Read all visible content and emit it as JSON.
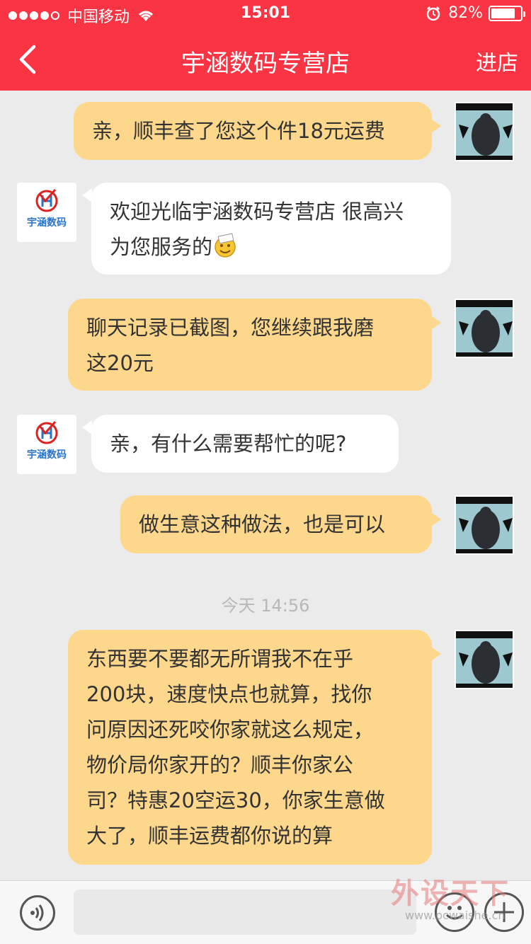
{
  "status_bar": {
    "carrier": "中国移动",
    "time": "15:01",
    "battery_percent": "82%",
    "battery_level": 0.82,
    "signal_bars": 4
  },
  "nav": {
    "title": "宇涵数码专营店",
    "right_label": "进店",
    "back_icon": "chevron-left-icon"
  },
  "shop": {
    "logo_text": "宇涵数码"
  },
  "messages": [
    {
      "from": "user",
      "text": "亲，顺丰查了您这个件18元运费"
    },
    {
      "from": "shop",
      "lines": [
        "欢迎光临宇涵数码专营店 很高兴",
        "为您服务的"
      ],
      "emoji": "smiley-icon"
    },
    {
      "from": "user",
      "lines": [
        "聊天记录已截图，您继续跟我磨",
        "这20元"
      ]
    },
    {
      "from": "shop",
      "text": "亲，有什么需要帮忙的呢?"
    },
    {
      "from": "user",
      "text": "做生意这种做法，也是可以"
    },
    {
      "from": "user",
      "lines": [
        "东西要不要都无所谓我不在乎",
        "200块，速度快点也就算，找你",
        "问原因还死咬你家就这么规定，",
        "物价局你家开的？顺丰你家公",
        "司？特惠20空运30，你家生意做",
        "大了，顺丰运费都你说的算"
      ]
    }
  ],
  "timestamp": "今天 14:56",
  "input": {
    "value": "",
    "voice_icon": "voice-icon",
    "emoji_icon": "emoji-icon",
    "plus_icon": "plus-icon"
  },
  "watermark": {
    "text": "外设天下",
    "url": "www.pcwaishe.cn"
  },
  "colors": {
    "header": "#fb3443",
    "outgoing_bubble": "#fdd78c",
    "incoming_bubble": "#ffffff",
    "background": "#ebebeb"
  }
}
